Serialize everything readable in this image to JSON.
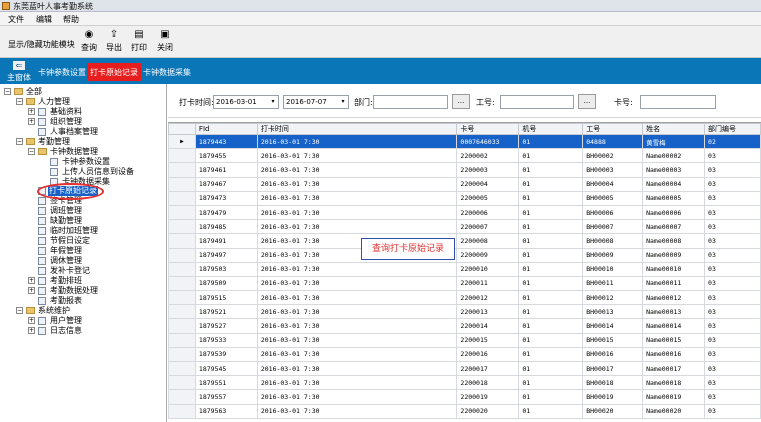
{
  "window": {
    "title": "东莞蓝叶人事考勤系统"
  },
  "menu": [
    "文件",
    "编辑",
    "帮助"
  ],
  "toolbar": {
    "toggle_label": "显示/隐藏功能模块",
    "query": "查询",
    "export": "导出",
    "print": "打印",
    "close": "关闭"
  },
  "tabs": {
    "home": "主窗体",
    "items": [
      "卡钟参数设置",
      "打卡原始记录",
      "卡钟数据采集"
    ]
  },
  "tree": {
    "all": "全部",
    "hr": "人力管理",
    "basic": "基础资料",
    "org": "组织管理",
    "files": "人事档案管理",
    "att": "考勤管理",
    "clock": "卡钟数据管理",
    "clock_param": "卡钟参数设置",
    "upload": "上传人员信息到设备",
    "collect": "卡钟数据采集",
    "raw": "打卡原始记录",
    "sign": "签卡管理",
    "shift": "调班管理",
    "leave": "缺勤管理",
    "ot": "临时加班管理",
    "holiday": "节假日设定",
    "annual": "年假管理",
    "rest": "调休管理",
    "allowance": "发补卡登记",
    "schedule": "考勤排班",
    "process": "考勤数据处理",
    "report": "考勤报表",
    "sys": "系统维护",
    "users": "用户管理",
    "log": "日志信息"
  },
  "filter": {
    "time_label": "打卡时间:",
    "date_from": "2016-03-01",
    "date_to": "2016-07-07",
    "dept_label": "部门:",
    "dept_value": "",
    "ellipsis": "...",
    "empno_label": "工号:",
    "empno_value": "",
    "card_label": "卡号:",
    "card_value": ""
  },
  "grid": {
    "columns": [
      "FId",
      "打卡时间",
      "卡号",
      "机号",
      "工号",
      "姓名",
      "部门编号"
    ],
    "rows": [
      [
        "1879443",
        "2016-03-01 7:30",
        "0007646033",
        "01",
        "04888",
        "黄雪梅",
        "02"
      ],
      [
        "1879455",
        "2016-03-01 7:30",
        "2200002",
        "01",
        "BH00002",
        "Name00002",
        "03"
      ],
      [
        "1879461",
        "2016-03-01 7:30",
        "2200003",
        "01",
        "BH00003",
        "Name00003",
        "03"
      ],
      [
        "1879467",
        "2016-03-01 7:30",
        "2200004",
        "01",
        "BH00004",
        "Name00004",
        "03"
      ],
      [
        "1879473",
        "2016-03-01 7:30",
        "2200005",
        "01",
        "BH00005",
        "Name00005",
        "03"
      ],
      [
        "1879479",
        "2016-03-01 7:30",
        "2200006",
        "01",
        "BH00006",
        "Name00006",
        "03"
      ],
      [
        "1879485",
        "2016-03-01 7:30",
        "2200007",
        "01",
        "BH00007",
        "Name00007",
        "03"
      ],
      [
        "1879491",
        "2016-03-01 7:30",
        "2200008",
        "01",
        "BH00008",
        "Name00008",
        "03"
      ],
      [
        "1879497",
        "2016-03-01 7:30",
        "2200009",
        "01",
        "BH00009",
        "Name00009",
        "03"
      ],
      [
        "1879503",
        "2016-03-01 7:30",
        "2200010",
        "01",
        "BH00010",
        "Name00010",
        "03"
      ],
      [
        "1879509",
        "2016-03-01 7:30",
        "2200011",
        "01",
        "BH00011",
        "Name00011",
        "03"
      ],
      [
        "1879515",
        "2016-03-01 7:30",
        "2200012",
        "01",
        "BH00012",
        "Name00012",
        "03"
      ],
      [
        "1879521",
        "2016-03-01 7:30",
        "2200013",
        "01",
        "BH00013",
        "Name00013",
        "03"
      ],
      [
        "1879527",
        "2016-03-01 7:30",
        "2200014",
        "01",
        "BH00014",
        "Name00014",
        "03"
      ],
      [
        "1879533",
        "2016-03-01 7:30",
        "2200015",
        "01",
        "BH00015",
        "Name00015",
        "03"
      ],
      [
        "1879539",
        "2016-03-01 7:30",
        "2200016",
        "01",
        "BH00016",
        "Name00016",
        "03"
      ],
      [
        "1879545",
        "2016-03-01 7:30",
        "2200017",
        "01",
        "BH00017",
        "Name00017",
        "03"
      ],
      [
        "1879551",
        "2016-03-01 7:30",
        "2200018",
        "01",
        "BH00018",
        "Name00018",
        "03"
      ],
      [
        "1879557",
        "2016-03-01 7:30",
        "2200019",
        "01",
        "BH00019",
        "Name00019",
        "03"
      ],
      [
        "1879563",
        "2016-03-01 7:30",
        "2200020",
        "01",
        "BH00020",
        "Name00020",
        "03"
      ]
    ],
    "current_marker": "▶"
  },
  "annotation": "查询打卡原始记录",
  "colors": {
    "tabbar": "#0a76b8",
    "active_tab": "#e81e1e",
    "selection": "#1662c8",
    "annotation_red": "#e43030"
  }
}
